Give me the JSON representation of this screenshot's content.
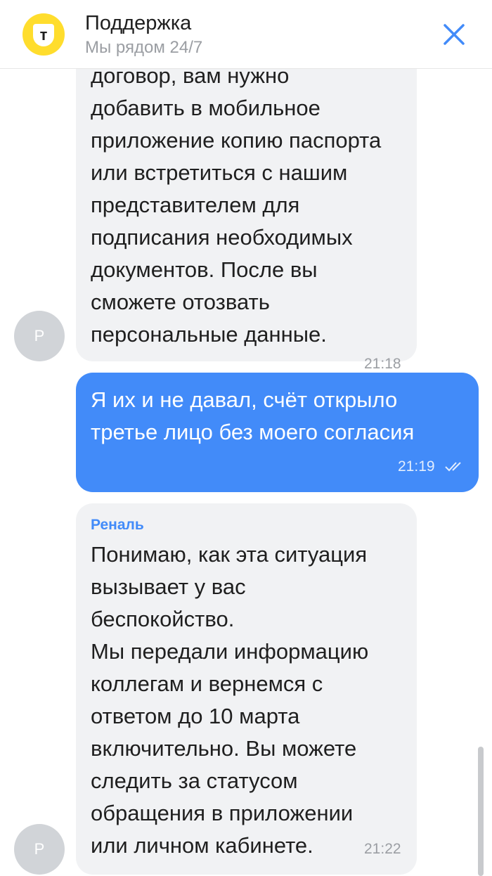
{
  "header": {
    "title": "Поддержка",
    "subtitle": "Мы рядом 24/7",
    "logo_letter": "т",
    "close_icon": "close-icon"
  },
  "messages": [
    {
      "direction": "incoming",
      "avatar_letter": "Р",
      "text": "договор, вам нужно\nдобавить в мобильное\nприложение копию паспорта\nили встретиться с нашим\nпредставителем для\nподписания необходимых\nдокументов. После вы\nсможете отозвать\nперсональные данные.",
      "time": "21:18"
    },
    {
      "direction": "outgoing",
      "text": "Я их и не давал, счёт открыло\nтретье лицо без моего согласия",
      "time": "21:19",
      "status_icon": "double-check-icon"
    },
    {
      "direction": "incoming",
      "avatar_letter": "Р",
      "sender": "Реналь",
      "text": "Понимаю, как эта ситуация\nвызывает у вас\nбеспокойство.\nМы передали информацию\nколлегам и вернемся с\nответом до 10 марта\nвключительно. Вы можете\nследить за статусом\nобращения в приложении\nили личном кабинете.",
      "time": "21:22"
    }
  ],
  "colors": {
    "brand_yellow": "#ffdd2d",
    "outgoing_bubble": "#428bf9",
    "incoming_bubble": "#f1f2f4",
    "sender_name": "#428bf9",
    "avatar": "#d1d4d8"
  }
}
